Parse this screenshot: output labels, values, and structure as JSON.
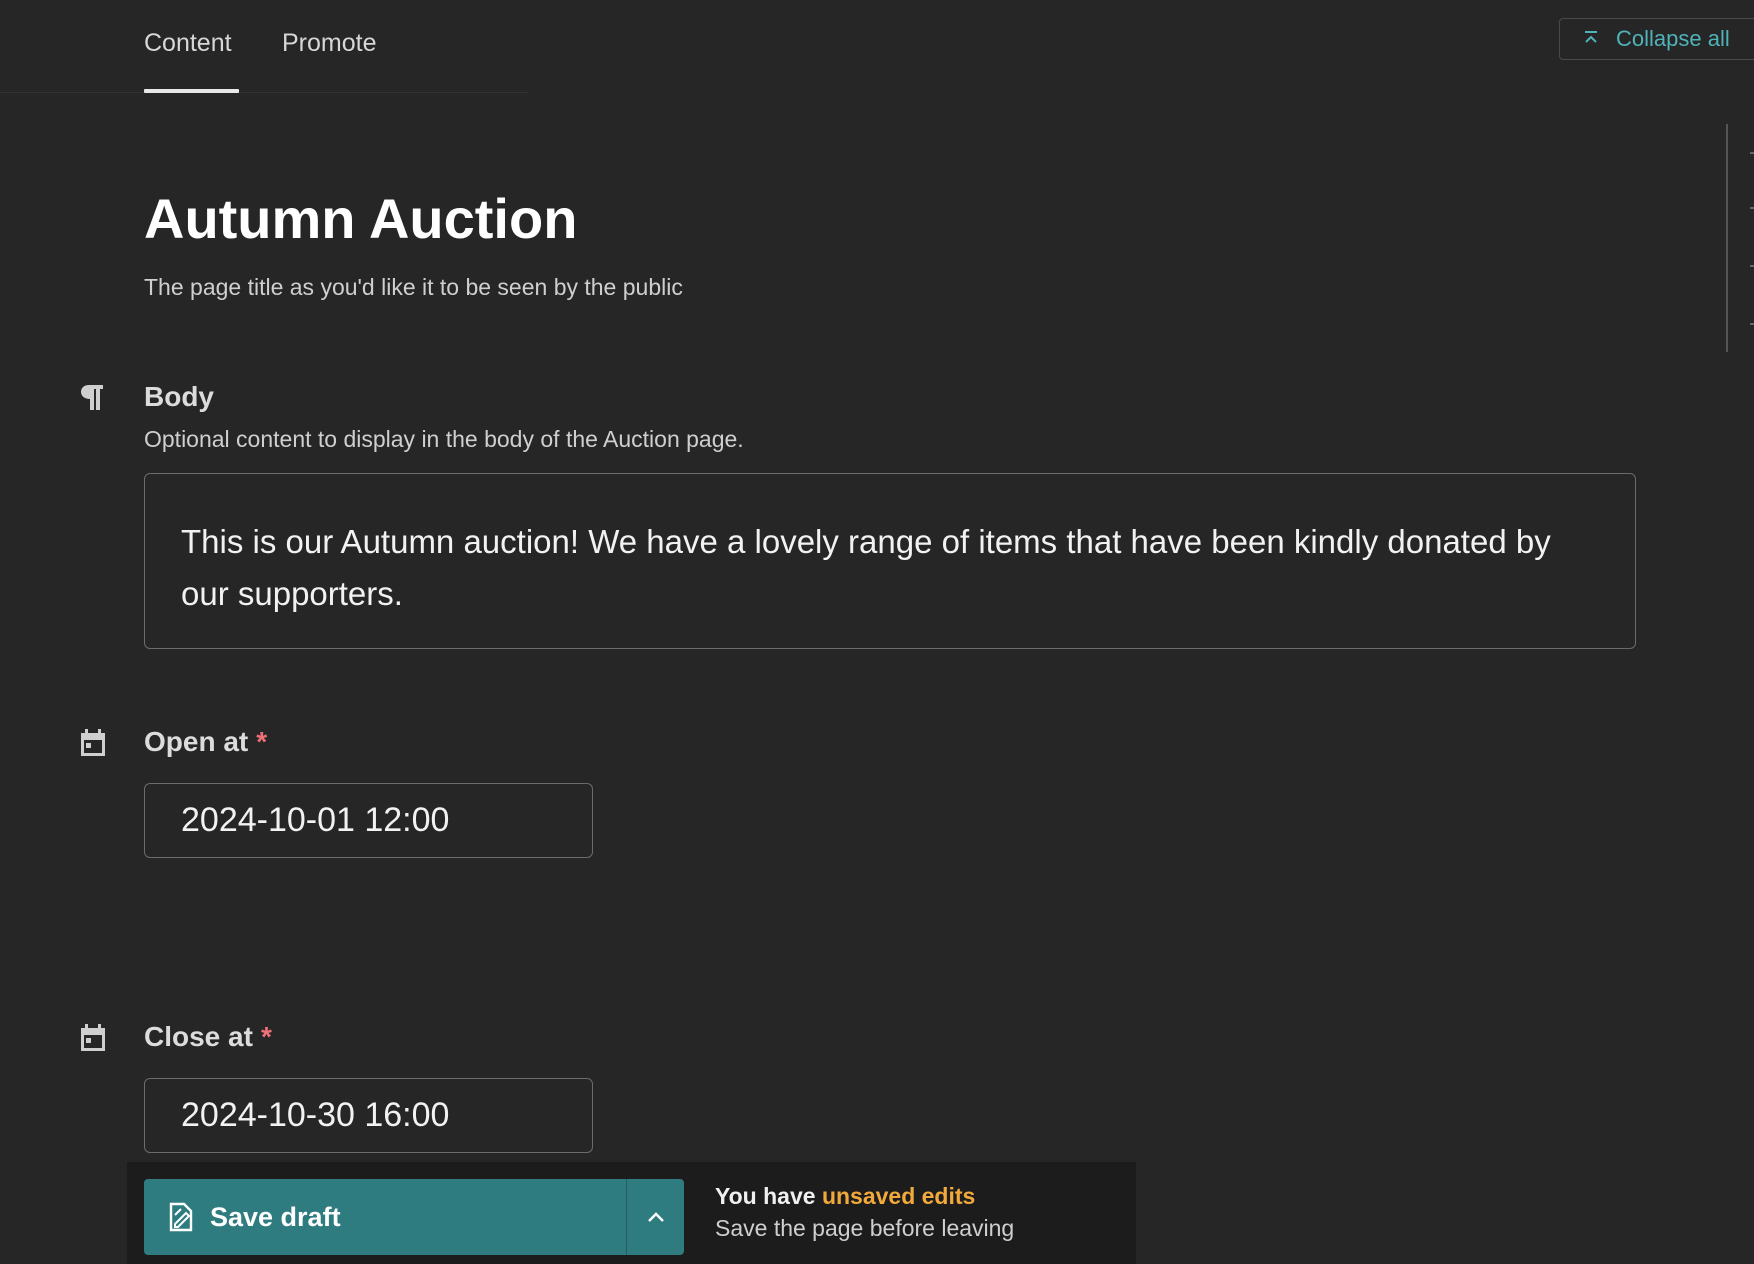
{
  "tabs": [
    {
      "label": "Content"
    },
    {
      "label": "Promote"
    }
  ],
  "toolbar": {
    "collapse_label": "Collapse all"
  },
  "page": {
    "title": "Autumn Auction",
    "title_help": "The page title as you'd like it to be seen by the public"
  },
  "fields": {
    "body": {
      "label": "Body",
      "help": "Optional content to display in the body of the Auction page.",
      "value": "This is our Autumn auction! We have a lovely range of items that have been kindly donated by our supporters."
    },
    "open_at": {
      "label": "Open at",
      "required_mark": "*",
      "value": "2024-10-01 12:00"
    },
    "close_at": {
      "label": "Close at",
      "required_mark": "*",
      "value": "2024-10-30 16:00"
    }
  },
  "footer": {
    "save_label": "Save draft",
    "unsaved_prefix": "You have ",
    "unsaved_highlight": "unsaved edits",
    "unsaved_sub": "Save the page before leaving"
  },
  "colors": {
    "accent": "#2e7c80",
    "link": "#4fb3b9",
    "warning": "#f2a93b",
    "required": "#f07078",
    "background": "#262626"
  }
}
